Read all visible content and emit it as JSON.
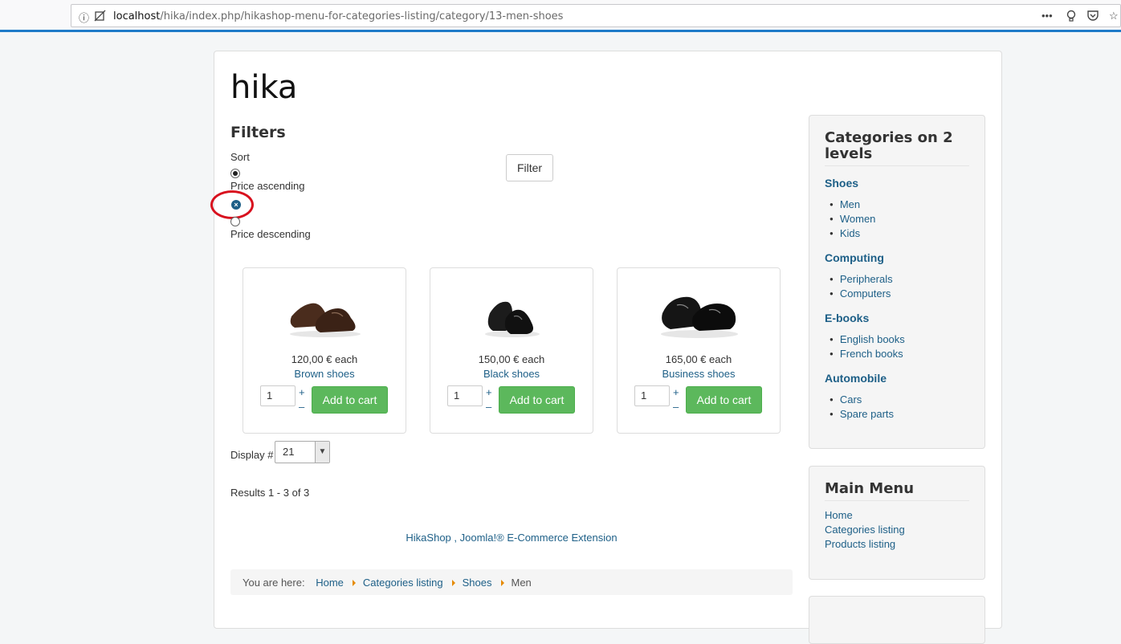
{
  "browser": {
    "url_prefix": "localhost",
    "url_path": "/hika/index.php/hikashop-menu-for-categories-listing/category/13-men-shoes"
  },
  "site": {
    "title": "hika"
  },
  "filters": {
    "title": "Filters",
    "sort_label": "Sort",
    "option_asc": "Price ascending",
    "option_desc": "Price descending",
    "filter_button": "Filter"
  },
  "products": [
    {
      "price": "120,00 € each",
      "name": "Brown shoes",
      "qty": "1",
      "cart": "Add to cart",
      "plus": "+",
      "minus": "–"
    },
    {
      "price": "150,00 € each",
      "name": "Black shoes",
      "qty": "1",
      "cart": "Add to cart",
      "plus": "+",
      "minus": "–"
    },
    {
      "price": "165,00 € each",
      "name": "Business shoes",
      "qty": "1",
      "cart": "Add to cart",
      "plus": "+",
      "minus": "–"
    }
  ],
  "listing": {
    "display_label": "Display #",
    "display_value": "21",
    "results": "Results 1 - 3 of 3",
    "footer": "HikaShop , Joomla!® E-Commerce Extension"
  },
  "breadcrumb": {
    "prefix": "You are here:",
    "items": [
      "Home",
      "Categories listing",
      "Shoes",
      "Men"
    ]
  },
  "categories_module": {
    "title": "Categories on 2 levels",
    "groups": [
      {
        "name": "Shoes",
        "items": [
          "Men",
          "Women",
          "Kids"
        ]
      },
      {
        "name": "Computing",
        "items": [
          "Peripherals",
          "Computers"
        ]
      },
      {
        "name": "E-books",
        "items": [
          "English books",
          "French books"
        ]
      },
      {
        "name": "Automobile",
        "items": [
          "Cars",
          "Spare parts"
        ]
      }
    ]
  },
  "main_menu": {
    "title": "Main Menu",
    "items": [
      "Home",
      "Categories listing",
      "Products listing"
    ]
  },
  "colors": {
    "link": "#1d5f87",
    "button_green": "#5cb85c",
    "annotation_red": "#d8101e",
    "accent_bar": "#1e7bc8"
  }
}
